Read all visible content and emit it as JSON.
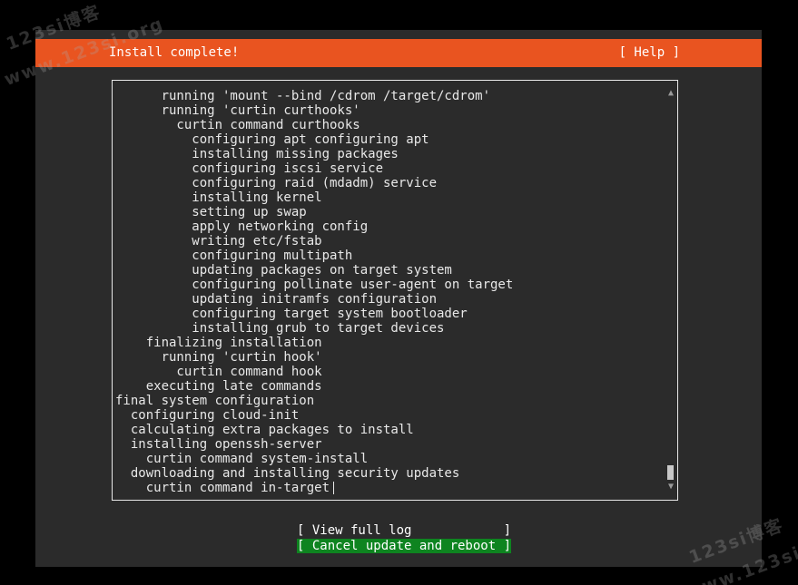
{
  "header": {
    "title": "Install complete!",
    "help_label": "[ Help ]"
  },
  "log": {
    "lines": [
      "      running 'mount --bind /cdrom /target/cdrom'",
      "      running 'curtin curthooks'",
      "        curtin command curthooks",
      "          configuring apt configuring apt",
      "          installing missing packages",
      "          configuring iscsi service",
      "          configuring raid (mdadm) service",
      "          installing kernel",
      "          setting up swap",
      "          apply networking config",
      "          writing etc/fstab",
      "          configuring multipath",
      "          updating packages on target system",
      "          configuring pollinate user-agent on target",
      "          updating initramfs configuration",
      "          configuring target system bootloader",
      "          installing grub to target devices",
      "    finalizing installation",
      "      running 'curtin hook'",
      "        curtin command hook",
      "    executing late commands",
      "final system configuration",
      "  configuring cloud-init",
      "  calculating extra packages to install",
      "  installing openssh-server",
      "    curtin command system-install",
      "  downloading and installing security updates",
      "    curtin command in-target"
    ],
    "scroll_up_icon": "arrow-up",
    "scroll_down_icon": "arrow-down"
  },
  "buttons": {
    "view_full_log": "[ View full log            ]",
    "cancel_update_reboot": "[ Cancel update and reboot ]"
  },
  "watermark": {
    "line1": "123si博客",
    "line2": "www.123si.org"
  },
  "colors": {
    "header_bg": "#e95420",
    "screen_bg": "#2b2b2b",
    "focused_button_bg": "#0e8420"
  }
}
